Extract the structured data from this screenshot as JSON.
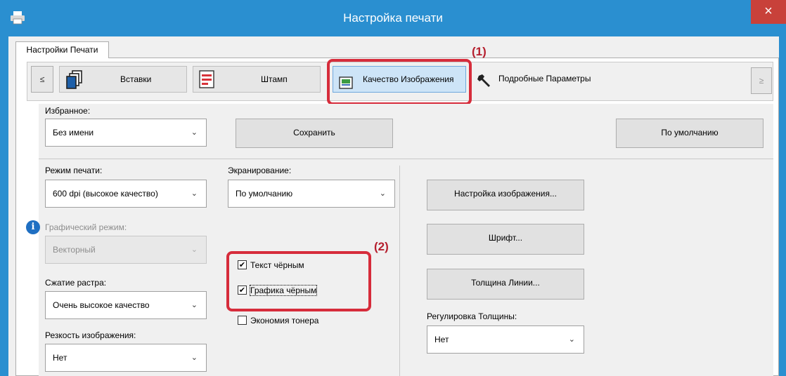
{
  "window": {
    "title": "Настройка печати",
    "close_glyph": "×",
    "icon": "printer-icon"
  },
  "main_tab": {
    "label": "Настройки Печати"
  },
  "subtabs": {
    "prev": "≤",
    "next": "≥",
    "items": [
      {
        "label": "Вставки",
        "icon": "copies-icon"
      },
      {
        "label": "Штамп",
        "icon": "stamp-icon"
      },
      {
        "label": "Качество Изображения",
        "icon": "image-quality-icon",
        "active": true
      },
      {
        "label": "Подробные Параметры",
        "icon": "wrench-icon"
      }
    ]
  },
  "annotations": {
    "label1": "(1)",
    "label2": "(2)",
    "color": "#d62c3b"
  },
  "favorites": {
    "label": "Избранное:",
    "value": "Без имени",
    "save": "Сохранить",
    "defaults": "По умолчанию"
  },
  "print_mode": {
    "label": "Режим печати:",
    "value": "600 dpi (высокое качество)"
  },
  "graphics_mode": {
    "label": "Графический режим:",
    "value": "Векторный",
    "info_icon": "i"
  },
  "raster_compression": {
    "label": "Сжатие растра:",
    "value": "Очень высокое качество"
  },
  "sharpness": {
    "label": "Резкость изображения:",
    "value": "Нет"
  },
  "screening": {
    "label": "Экранирование:",
    "value": "По умолчанию"
  },
  "checkboxes": [
    {
      "label": "Текст чёрным",
      "checked": true
    },
    {
      "label": "Графика чёрным",
      "checked": true
    },
    {
      "label": "Экономия тонера",
      "checked": false
    }
  ],
  "buttons": {
    "image_adjust": "Настройка изображения...",
    "font": "Шрифт...",
    "line_width": "Толщина Линии..."
  },
  "thickness": {
    "label": "Регулировка Толщины:",
    "value": "Нет"
  },
  "check_glyph": "✔",
  "arrow_glyph": "⌄"
}
